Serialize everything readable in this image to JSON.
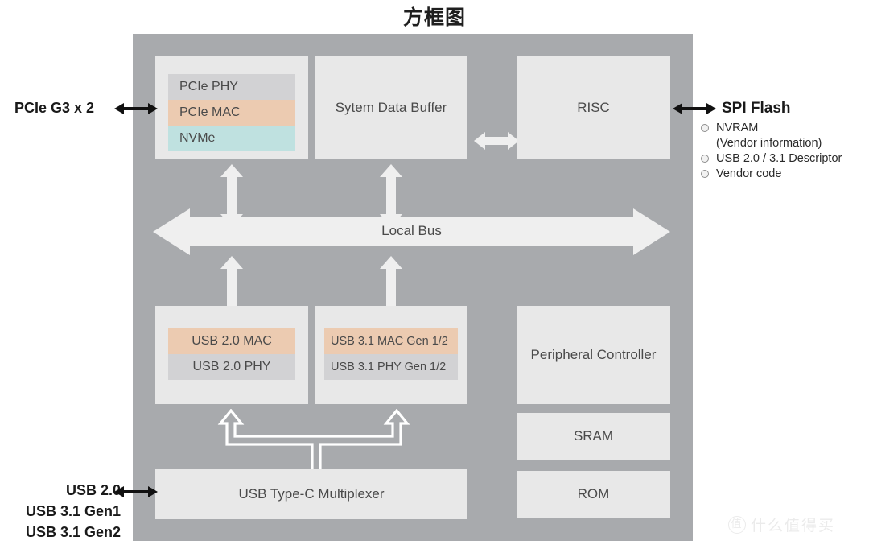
{
  "title": "方框图",
  "panel": {
    "blocks": {
      "pcie_stack": [
        "PCIe PHY",
        "PCIe MAC",
        "NVMe"
      ],
      "system_data_buffer": "Sytem Data Buffer",
      "risc": "RISC",
      "local_bus": "Local Bus",
      "usb2_stack": [
        "USB 2.0 MAC",
        "USB 2.0 PHY"
      ],
      "usb31_stack": [
        "USB 3.1 MAC Gen 1/2",
        "USB 3.1 PHY Gen 1/2"
      ],
      "peripheral_controller": "Peripheral Controller",
      "sram": "SRAM",
      "rom": "ROM",
      "type_c_multiplexer": "USB Type-C Multiplexer"
    }
  },
  "left_labels": {
    "pcie": "PCIe G3 x 2",
    "usb": [
      "USB 2.0",
      "USB 3.1 Gen1",
      "USB 3.1 Gen2"
    ]
  },
  "right_labels": {
    "spi_flash": "SPI Flash",
    "spi_items": [
      {
        "text": "NVRAM",
        "bullet": true
      },
      {
        "text": "(Vendor information)",
        "bullet": false
      },
      {
        "text": "USB 2.0 / 3.1 Descriptor",
        "bullet": true
      },
      {
        "text": "Vendor code",
        "bullet": true
      }
    ]
  },
  "watermark": {
    "mark": "值",
    "text": "什么值得买"
  },
  "colors": {
    "panel_gray": "#a8aaad",
    "box_light": "#e8e8e8",
    "sub_gray": "#d2d2d4",
    "sub_peach": "#eccbb1",
    "sub_teal": "#bfe1e0",
    "arrow_white": "#efefef",
    "text_dark": "#1a1a1a"
  }
}
